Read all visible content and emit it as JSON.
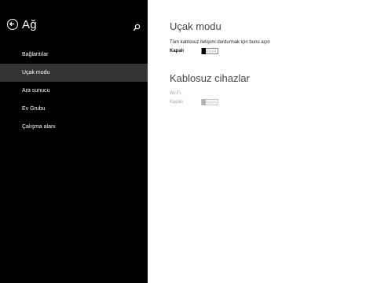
{
  "sidebar": {
    "title": "Ağ",
    "items": [
      {
        "label": "Bağlantılar"
      },
      {
        "label": "Uçak modu"
      },
      {
        "label": "Ara sunucu"
      },
      {
        "label": "Ev Grubu"
      },
      {
        "label": "Çalışma alanı"
      }
    ],
    "active_index": 1,
    "icons": {
      "back": "back-arrow-icon",
      "search": "search-icon"
    }
  },
  "airplane": {
    "title": "Uçak modu",
    "description": "Tüm kablosuz iletişimi durdurmak için bunu açın",
    "state": "Kapalı"
  },
  "wireless": {
    "title": "Kablosuz cihazlar",
    "wifi_label": "Wi-Fi",
    "wifi_state": "Kapalı"
  },
  "colors": {
    "sidebar_bg": "#000000",
    "active_item_bg": "#333333",
    "content_bg": "#ffffff",
    "disabled_text": "#a6a6a6"
  }
}
